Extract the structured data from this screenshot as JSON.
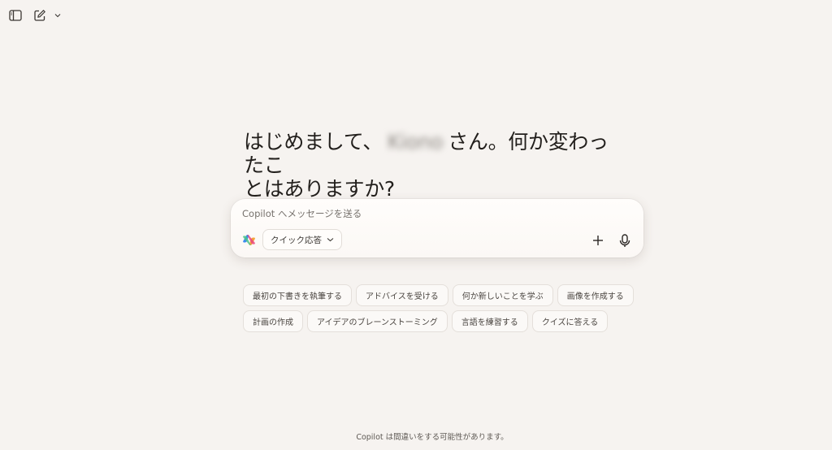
{
  "topbar": {
    "sidebar_icon": "sidebar-toggle-icon",
    "new_chat_icon": "compose-icon",
    "dropdown_icon": "chevron-down-icon"
  },
  "greeting": {
    "prefix": "はじめまして、",
    "name": "Kiono",
    "suffix_line1": "さん。何か変わったこ",
    "line2": "とはありますか?"
  },
  "composer": {
    "placeholder": "Copilot へメッセージを送る",
    "mode_label": "クイック応答",
    "logo_icon": "copilot-logo-icon",
    "add_icon": "plus-icon",
    "mic_icon": "microphone-icon"
  },
  "suggestions": {
    "row1": [
      "最初の下書きを執筆する",
      "アドバイスを受ける",
      "何か新しいことを学ぶ",
      "画像を作成する"
    ],
    "row2": [
      "計画の作成",
      "アイデアのブレーンストーミング",
      "言語を練習する",
      "クイズに答える"
    ]
  },
  "footer": {
    "disclaimer": "Copilot は間違いをする可能性があります。"
  }
}
